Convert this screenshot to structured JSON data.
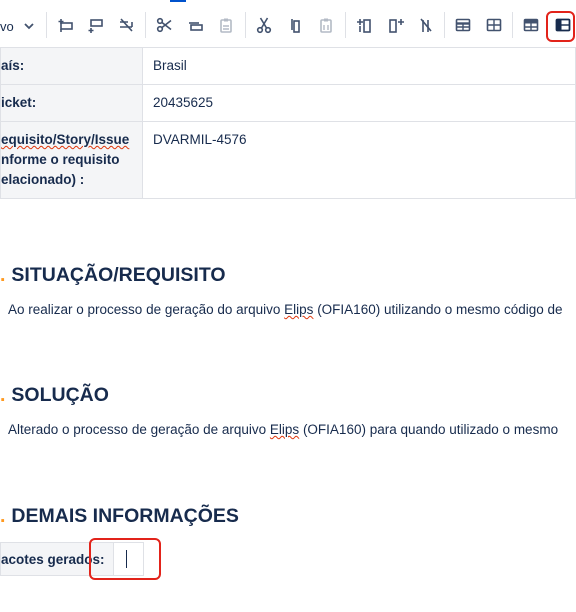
{
  "toolbar": {
    "style_select": "vo",
    "icons": [
      "insert-row-before-icon",
      "insert-row-after-icon",
      "delete-row-icon",
      "cut-icon",
      "copy-row-icon",
      "paste-row-icon",
      "cut-column-icon",
      "copy-column-icon",
      "paste-column-icon",
      "insert-column-before-icon",
      "insert-column-after-icon",
      "delete-column-icon",
      "table-header-row-icon",
      "table-header-col-icon",
      "table-cell-properties-icon",
      "table-sidebar-toggle-icon"
    ]
  },
  "info_table": {
    "rows": [
      {
        "label": "aís:",
        "value": "Brasil"
      },
      {
        "label": "icket:",
        "value": "20435625"
      },
      {
        "label_lines": [
          "equisito/Story/Issue",
          "nforme o requisito",
          "elacionado) :"
        ],
        "value": "DVARMIL-4576"
      }
    ]
  },
  "sections": [
    {
      "num": ".",
      "title": "SITUAÇÃO/REQUISITO",
      "text": "Ao realizar o processo de geração do arquivo Elips (OFIA160) utilizando o mesmo código de"
    },
    {
      "num": ".",
      "title": "SOLUÇÃO",
      "text": "Alterado o processo de geração de arquivo Elips (OFIA160) para quando utilizado o mesmo"
    },
    {
      "num": ".",
      "title": "DEMAIS INFORMAÇÕES"
    }
  ],
  "packages": {
    "label": "acotes gerados:",
    "value": ""
  },
  "colors": {
    "accent": "#0052cc",
    "heading_number": "#ff991f",
    "highlight": "#e2231a",
    "text": "#172b4d"
  }
}
